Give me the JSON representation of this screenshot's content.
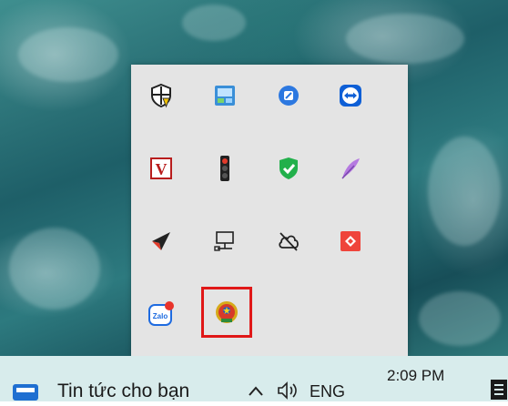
{
  "taskbar": {
    "news_label": "Tin tức cho bạn",
    "language": "ENG",
    "time": "2:09 PM"
  },
  "tray_icons": [
    "security-warning-icon",
    "network-tool-icon",
    "blue-app-icon",
    "teamviewer-icon",
    "v-app-icon",
    "traffic-light-icon",
    "shield-check-icon",
    "feather-icon",
    "send-arrow-icon",
    "monitor-network-icon",
    "cloud-off-icon",
    "anydesk-icon",
    "zalo-icon",
    "emblem-app-icon"
  ],
  "selected_icon": "emblem-app-icon"
}
